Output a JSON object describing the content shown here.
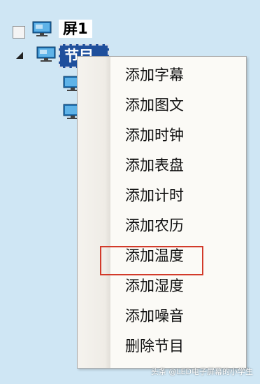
{
  "tree": {
    "screen_label": "屏1",
    "program_label": "节目",
    "icon": "monitor-icon"
  },
  "context_menu": {
    "items": [
      "添加字幕",
      "添加图文",
      "添加时钟",
      "添加表盘",
      "添加计时",
      "添加农历",
      "添加温度",
      "添加湿度",
      "添加噪音",
      "删除节目"
    ],
    "highlighted_item": "添加温度",
    "highlight_color": "#d23a2a"
  },
  "watermark": "头条 @LED电子屏幕的小学生",
  "colors": {
    "background": "#cfe6f4",
    "selection": "#1f4f9c"
  }
}
